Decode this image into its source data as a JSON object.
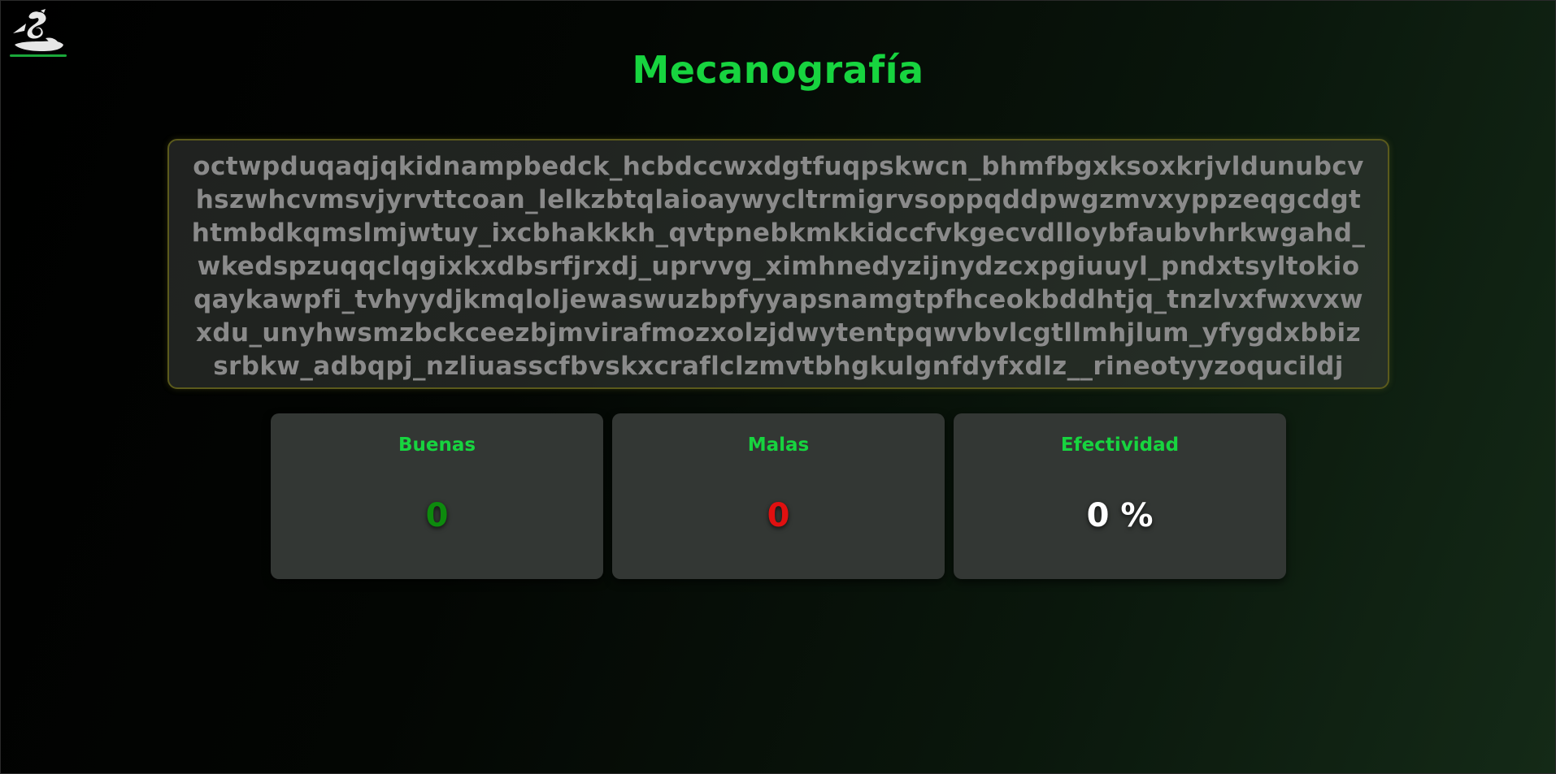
{
  "header": {
    "logo_icon": "dragon-logo-icon",
    "title": "Mecanografía"
  },
  "typing_text": {
    "lines": [
      "octwpduqaqjqkidnampbedck_hcbdccwxdgtfuqpskwcn_bhmfbgxksoxkrjvldunubcv",
      "hszwhcvmsvjyrvttcoan_lelkzbtqlaioaywycltrmigrvsoppqddpwgzmvxyppzeqgcdgt",
      "htmbdkqmslmjwtuy_ixcbhakkkh_qvtpnebkmkkidccfvkgecvdlloybfaubvhrkwgahd_",
      "wkedspzuqqclqgixkxdbsrfjrxdj_uprvvg_ximhnedyzijnydzcxpgiuuyl_pndxtsyltokio",
      "qaykawpfi_tvhyydjkmqloljewaswuzbpfyyapsnamgtpfhceokbddhtjq_tnzlvxfwxvxw",
      "xdu_unyhwsmzbckceezbjmvirafmozxolzjdwytentpqwvbvlcgtllmhjlum_yfygdxbbiz",
      "srbkw_adbqpj_nzliuasscfbvskxcraflclzmvtbhgkulgnfdyfxdlz__rineotyyzoqucildj"
    ]
  },
  "stats": {
    "good": {
      "label": "Buenas",
      "value": "0"
    },
    "bad": {
      "label": "Malas",
      "value": "0"
    },
    "effectiveness": {
      "label": "Efectividad",
      "value": "0 %"
    }
  },
  "colors": {
    "accent": "#17d43f",
    "good": "#0d8a0d",
    "bad": "#e01010",
    "text_muted": "#8a8a8a"
  }
}
